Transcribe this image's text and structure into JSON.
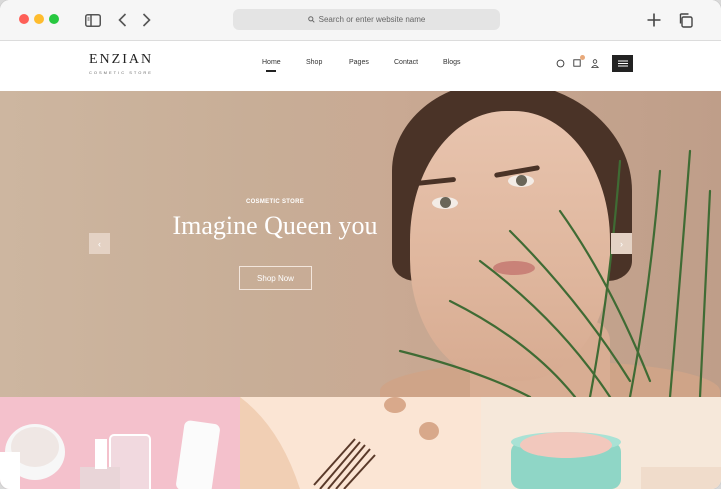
{
  "browser": {
    "address_placeholder": "Search or enter website name"
  },
  "site": {
    "logo_text": "ENZIAN",
    "logo_tagline": "COSMETIC STORE",
    "nav": [
      "Home",
      "Shop",
      "Pages",
      "Contact",
      "Blogs"
    ],
    "active_nav": "Home"
  },
  "hero": {
    "subtitle": "COSMETIC STORE",
    "title": "Imagine Queen you",
    "button_label": "Shop Now",
    "prev_arrow": "‹",
    "next_arrow": "›"
  },
  "colors": {
    "accent_dot": "#e8a97a",
    "dark": "#222222"
  },
  "icons": {
    "header": [
      "search-icon",
      "cart-icon",
      "user-icon",
      "menu-icon"
    ],
    "chrome": [
      "sidebar-toggle-icon",
      "back-icon",
      "forward-icon",
      "new-tab-icon",
      "tabs-overview-icon"
    ]
  }
}
